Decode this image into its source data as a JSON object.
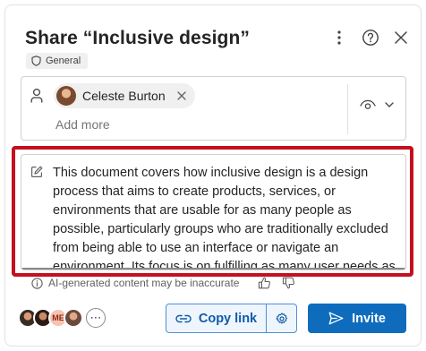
{
  "dialog": {
    "title": "Share “Inclusive design”",
    "sensitivity_label": "General",
    "icons": {
      "more": "more-vertical-icon",
      "help": "help-icon",
      "close": "close-icon"
    }
  },
  "recipients": {
    "chips": [
      {
        "name": "Celeste Burton"
      }
    ],
    "add_more_placeholder": "Add more",
    "permission_icon": "eye-icon"
  },
  "message": {
    "text": "This document covers how inclusive design is a design process that aims to create products, services, or environments that are usable for as many people as possible, particularly groups who are traditionally excluded from being able to use an interface or navigate an environment. Its focus is on fulfilling as many user needs as possible, not just as many users as possible."
  },
  "ai_notice": {
    "text": "AI-generated content may be inaccurate"
  },
  "footer": {
    "shared_with_initials": "ME",
    "copy_link_label": "Copy link",
    "invite_label": "Invite"
  },
  "colors": {
    "highlight_outline": "#c50f1f",
    "primary": "#0f6cbd",
    "copy_link_text": "#0f5ba8"
  }
}
